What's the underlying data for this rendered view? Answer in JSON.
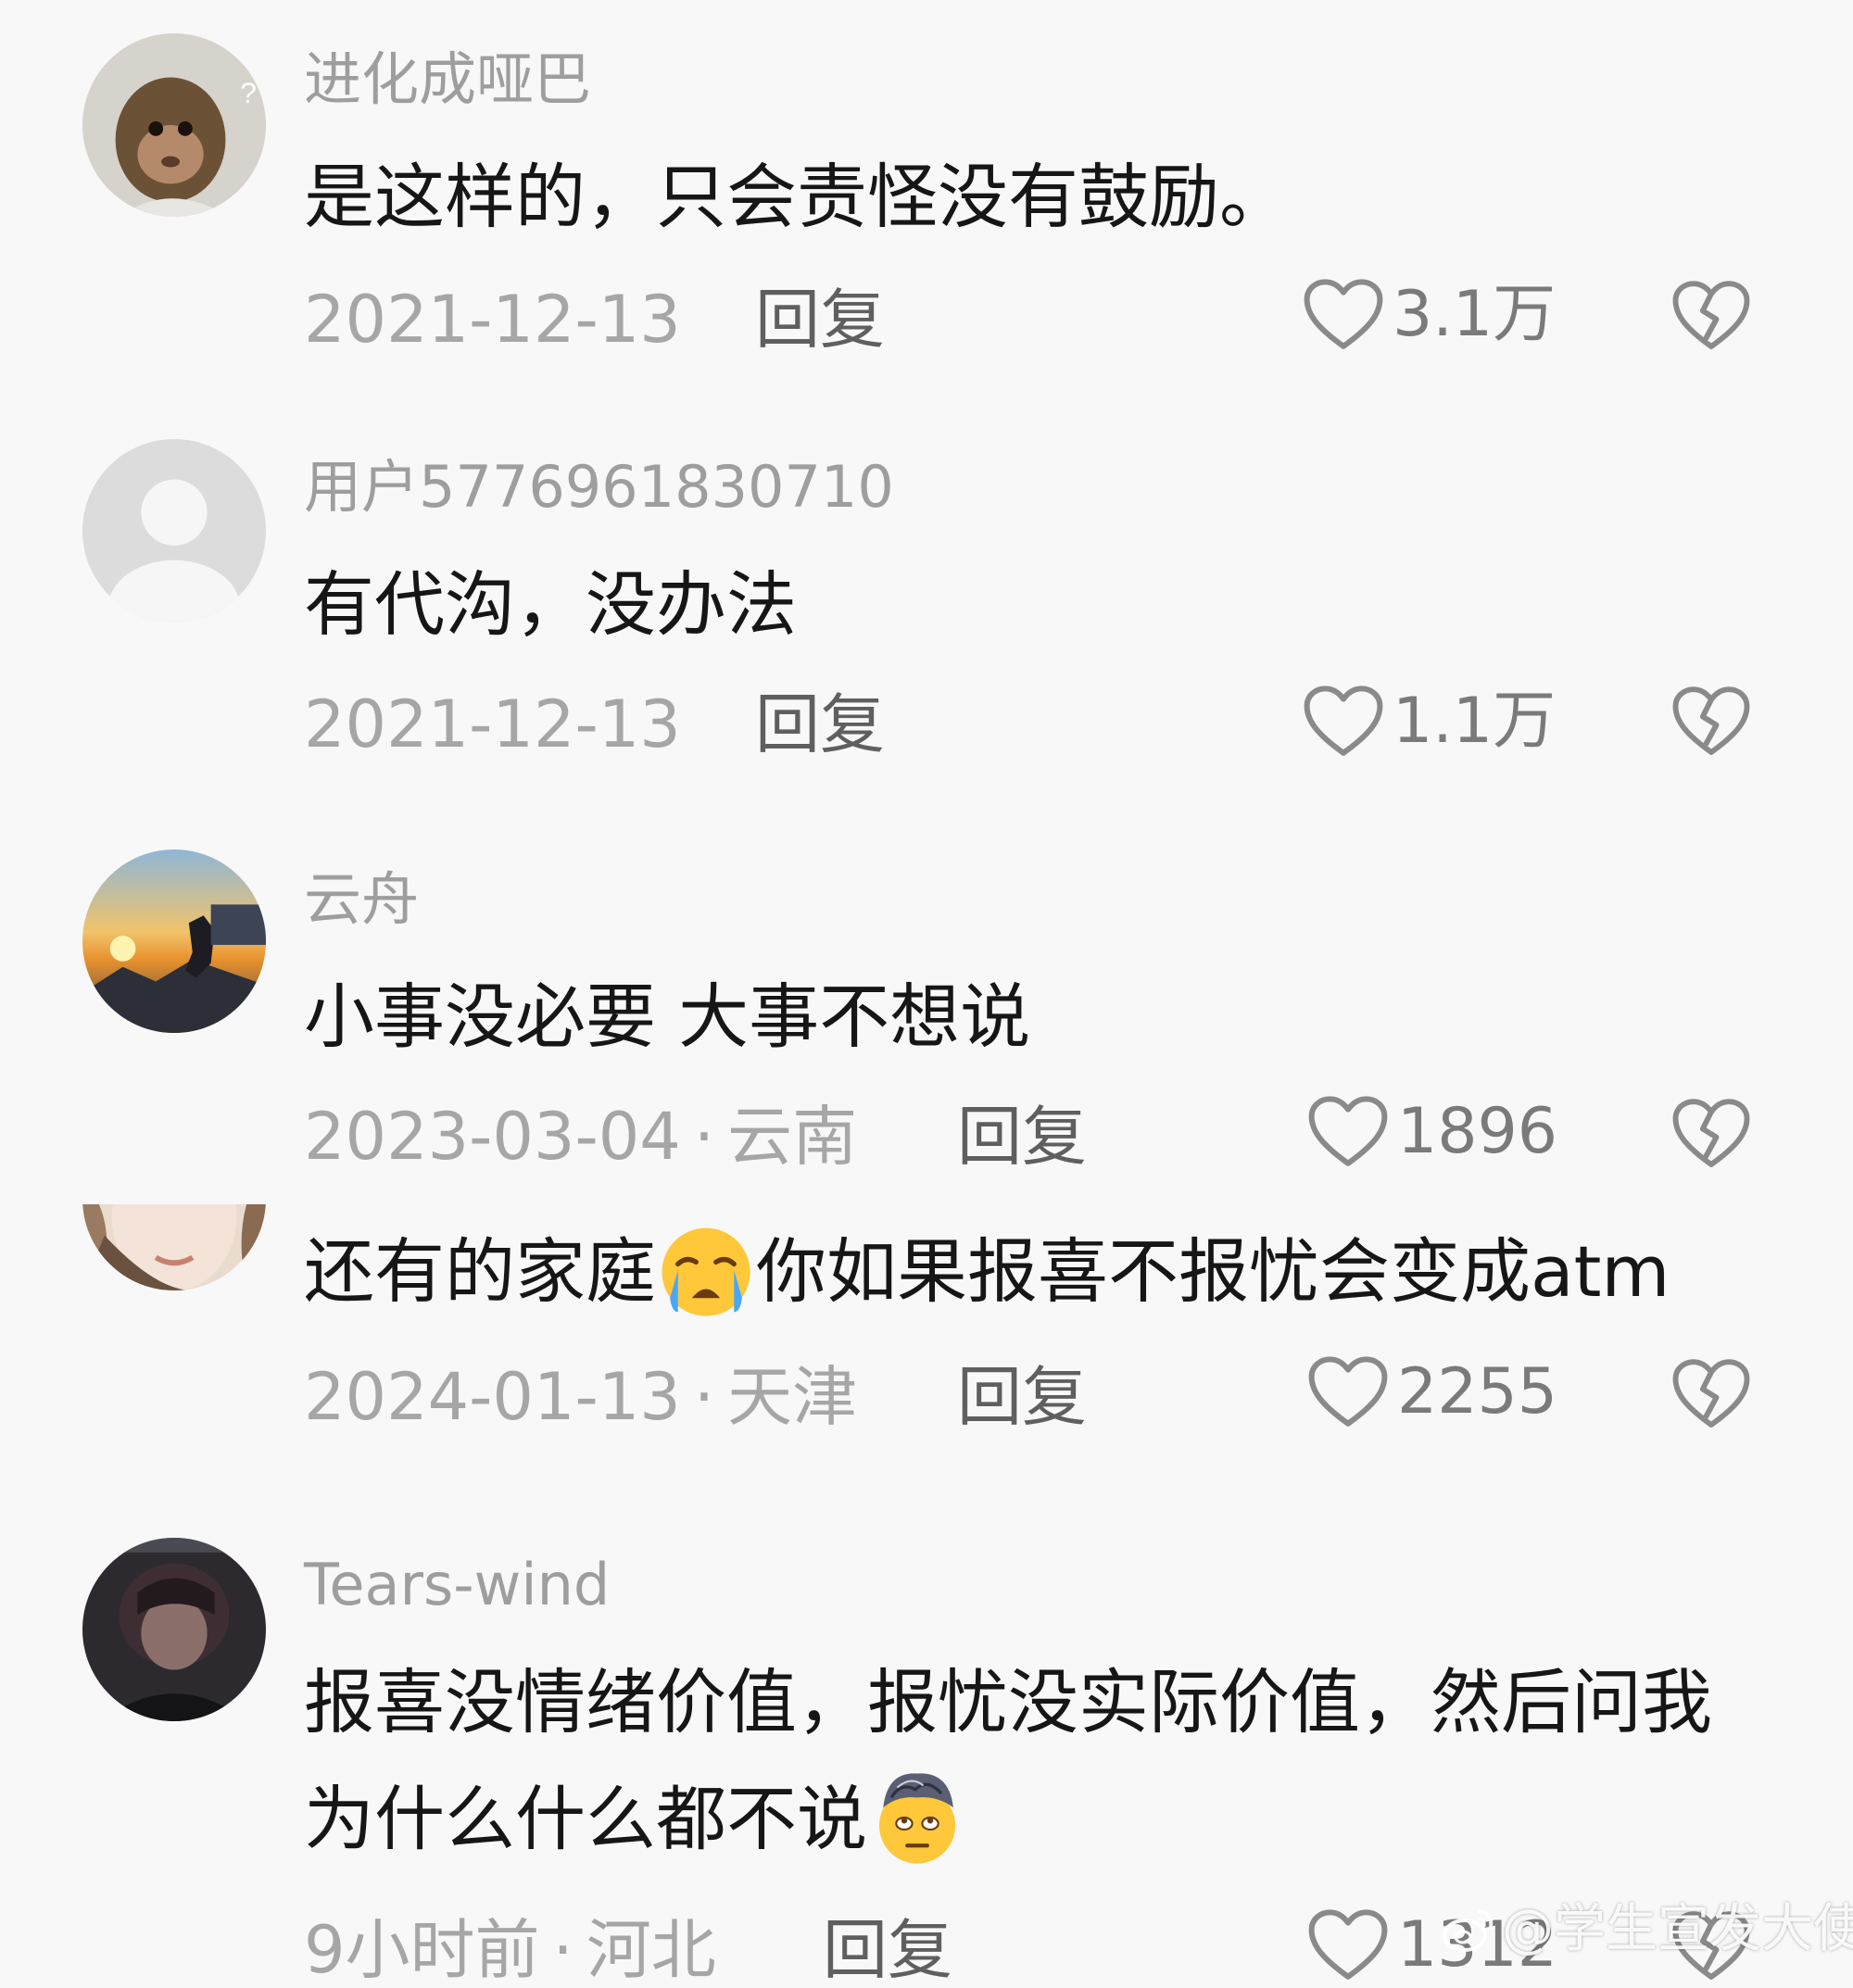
{
  "comments": [
    {
      "username": "进化成哑巴",
      "content": "是这样的，只会责怪没有鼓励。",
      "date": "2021-12-13",
      "location": "",
      "reply_label": "回复",
      "likes": "3.1万",
      "avatar_icon": "monkey-avatar"
    },
    {
      "username": "用户5776961830710",
      "content": "有代沟，没办法",
      "date": "2021-12-13",
      "location": "",
      "reply_label": "回复",
      "likes": "1.1万",
      "avatar_icon": "default-user-avatar"
    },
    {
      "username": "云舟",
      "content": "小事没必要  大事不想说",
      "date": "2023-03-04",
      "location": "云南",
      "reply_label": "回复",
      "likes": "1896",
      "avatar_icon": "sunset-mountain-avatar"
    },
    {
      "username": "",
      "content_before_emoji": "还有的家庭",
      "content_after_emoji": "你如果报喜不报忧会变成atm",
      "emoji": "crying-face",
      "date": "2024-01-13",
      "location": "天津",
      "reply_label": "回复",
      "likes": "2255",
      "avatar_icon": "girl-avatar"
    },
    {
      "username": "Tears-wind",
      "content_before_emoji": "报喜没情绪价值，报忧没实际价值，然后问我为什么什么都不说",
      "emoji": "face-with-spiral-hair",
      "date": "9小时前",
      "location": "河北",
      "reply_label": "回复",
      "likes": "1312",
      "avatar_icon": "dark-portrait-avatar"
    }
  ],
  "separator": "·",
  "watermark": "@学生宣发大使",
  "colors": {
    "background": "#f8f8f8",
    "username": "#9e9e9e",
    "content": "#161616",
    "meta": "#a6a6a6",
    "icon_stroke": "#8a8a8a"
  }
}
